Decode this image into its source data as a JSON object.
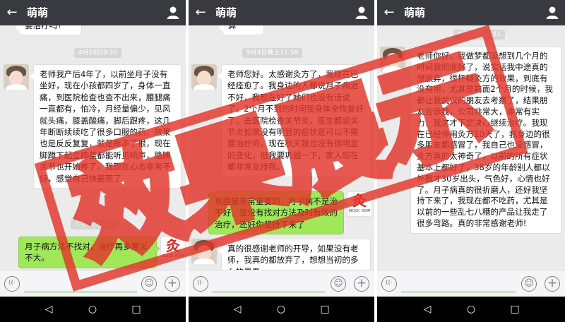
{
  "panels": [
    {
      "contact": "萌萌",
      "top_snippet": "要治疗吗?",
      "timestamp": "4月18日9:20",
      "msg1": "老师我产后4年了，以前坐月子没有坐好，现在小孩都四岁了，身体一直痛，到医院检查也查不出来，腰腿痛一直都有，怕冷，月经量偏少，见风就头痛，膝盖酸痛，脚后跟疼，这几年断断续续吃了很多口服的药，效果也是反反复复，就是断不了根，现在脚蹲下起立膝盖都能听见响声，胳膊关节也开始疼了。我现在心态非常不好，感觉自己快要死了",
      "hidden_stamp": "4月18日9:32",
      "reply1": "月子病方法不找对，治疗再多意义不大。"
    },
    {
      "contact": "萌萌",
      "top_snippet": "算",
      "timestamp": "9月4日晚上21:56",
      "msg1": "老师您好。太感谢灸方了，我现在已经痊愈了。我身边的人都说月子病治不好，我现在好了她们也没有话说了。2个月不到的时间我身体全恢复好了，去医院检查关节炎，医生都说关节炎如果没有明显的症状是可以不需要治疗的，现在秋天我也没有很明显的变化，但我要巩固一下，家人现在都非常支持我。",
      "reply1": "巩固是非常重要的，月子病不是治不好，是没有找对方法及时有效的治疗，还好你坚持下来了",
      "msg2": "真的很感谢老师的开导，如果没有老师，我真的都放弃了，想想当初的多么的愚蠢。"
    },
    {
      "contact": "萌萌",
      "timestamp": "9月13日18:51",
      "msg1": "老师你好，我做梦都没想到几个月的时间我彻底好了，说实话我中途真的想放弃，很怀疑灸方的效果，到底有没有用，尤其是前面2个月的时候，我都让我武汉的朋友去考察了，结果朋友告诉我，公司非常大，非常有实力，我这才下定决心继续治疗。我现在已经停用灸方10天了，我身边的很多朋友都感冒了，我自己也没感冒，灸方真的太神奇了，以前的所有症状基本上都好了，38岁的年龄别人都以外我才30岁出头，气色好，心情也好了。月子病真的很折磨人，还好我坚持下来了，我现在都不吃药，尤其是以前的一些乱七八糟的产品让我走了很多弯路。真的非常感谢老师!"
    }
  ],
  "logo": {
    "glyph": "灸",
    "caption": "BRICK ROOM"
  },
  "watermark": {
    "text": "效果展示",
    "color": "#e2352a"
  },
  "colors": {
    "titlebar": "#393a3f",
    "chat_bg": "#ebebeb",
    "sent_bubble": "#a0e75a",
    "received_bubble": "#ffffff",
    "input_underline": "#45c01a"
  }
}
